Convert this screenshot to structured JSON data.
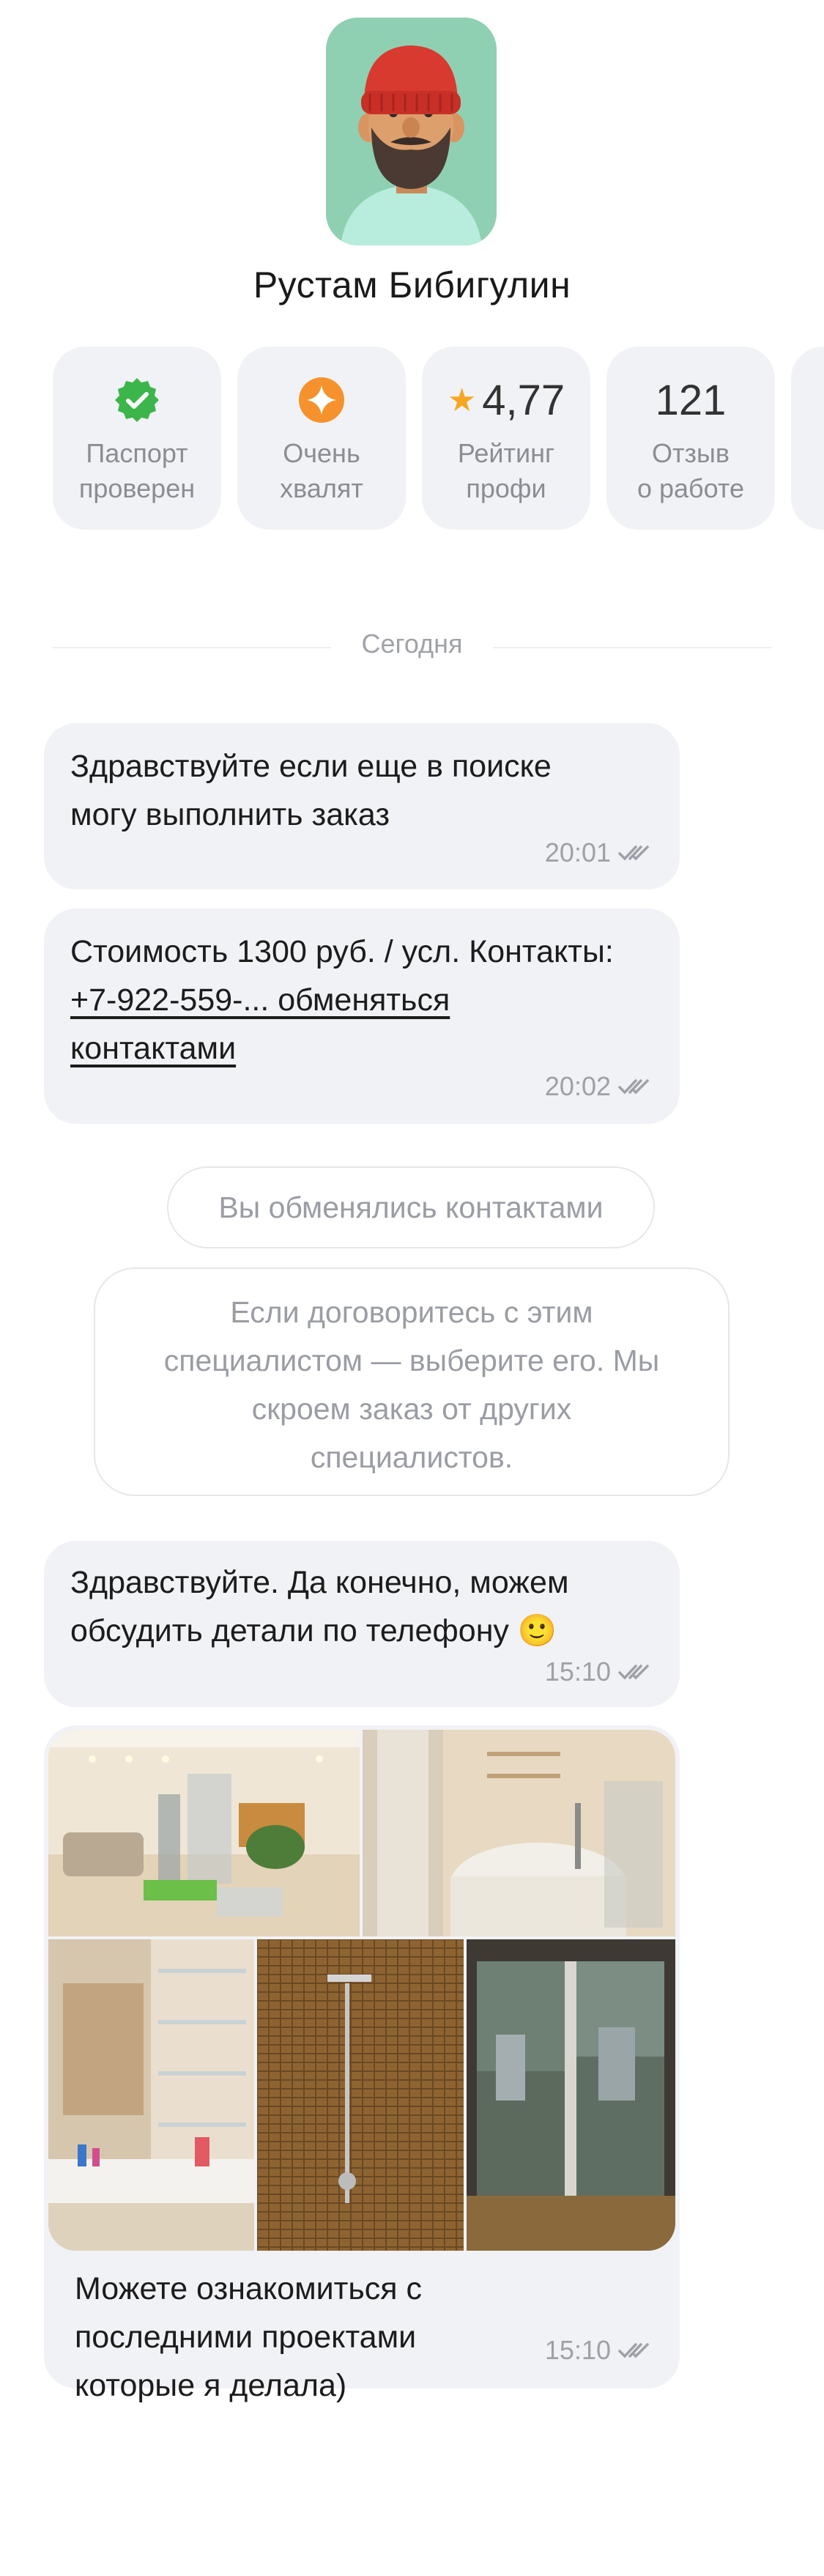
{
  "profile": {
    "name": "Рустам Бибигулин"
  },
  "badges": [
    {
      "line1": "Паспорт",
      "line2": "проверен",
      "icon": "check-shield-icon",
      "color": "#3cb54a"
    },
    {
      "line1": "Очень",
      "line2": "хвалят",
      "icon": "sparkle-icon",
      "color": "#f5922d"
    },
    {
      "value": "4,77",
      "line1": "Рейтинг",
      "line2": "профи",
      "icon": "star-icon",
      "color": "#f6a623"
    },
    {
      "value": "121",
      "line1": "Отзыв",
      "line2": "о работе"
    }
  ],
  "chat": {
    "date": "Сегодня",
    "messages": [
      {
        "line1": "Здравствуйте если еще в поиске",
        "line2": "могу выполнить заказ",
        "time": "20:01"
      },
      {
        "line1": "Стоимость 1300 руб. / усл. Контакты:",
        "link1": "+7-922-559-... обменяться",
        "link2": "контактами",
        "time": "20:02"
      },
      {
        "line1": "Здравствуйте. Да конечно, можем",
        "line2": "обсудить детали по телефону 🙂",
        "time": "15:10"
      },
      {
        "line1": "Можете ознакомиться с",
        "line2": "последними проектами",
        "line3": "которые я делала)",
        "time": "15:10"
      }
    ],
    "system_pill": "Вы обменялись контактами",
    "system_note": {
      "line1": "Если договоритесь с этим",
      "line2": "специалистом — выберите его. Мы",
      "line3": "скроем заказ от других",
      "line4": "специалистов."
    }
  }
}
